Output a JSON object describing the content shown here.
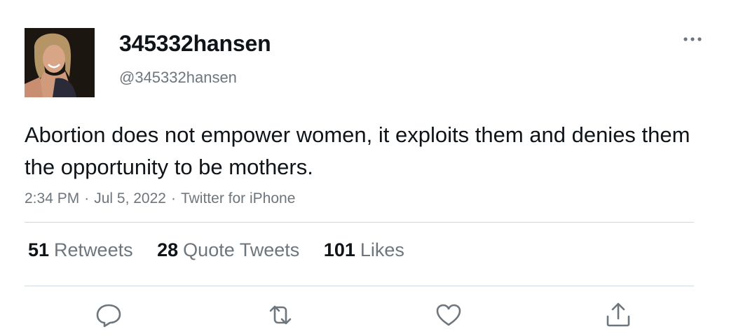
{
  "user": {
    "display_name": "345332hansen",
    "handle": "@345332hansen"
  },
  "tweet": {
    "text": "Abortion does not empower women, it exploits them and denies them the opportunity to be mothers.",
    "time": "2:34 PM",
    "date": "Jul 5, 2022",
    "source": "Twitter for iPhone",
    "separator": "·"
  },
  "stats": {
    "retweets_count": "51",
    "retweets_label": "Retweets",
    "quote_tweets_count": "28",
    "quote_tweets_label": "Quote Tweets",
    "likes_count": "101",
    "likes_label": "Likes"
  },
  "icons": {
    "more": "more-horizontal-icon",
    "reply": "reply-icon",
    "retweet": "retweet-icon",
    "like": "heart-icon",
    "share": "share-icon"
  },
  "colors": {
    "text_primary": "#0f1419",
    "text_secondary": "#6e767d",
    "divider": "#cfd9de"
  }
}
